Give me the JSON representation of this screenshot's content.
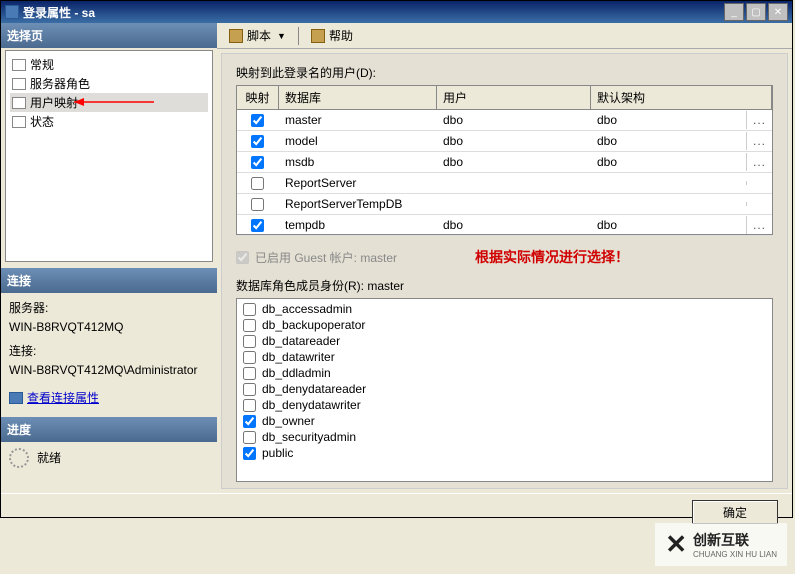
{
  "window": {
    "title": "登录属性 - sa"
  },
  "toolbar": {
    "script": "脚本",
    "help": "帮助"
  },
  "left": {
    "select_page_header": "选择页",
    "tree": [
      {
        "label": "常规"
      },
      {
        "label": "服务器角色"
      },
      {
        "label": "用户映射",
        "selected": true
      },
      {
        "label": "状态"
      }
    ],
    "conn_header": "连接",
    "server_label": "服务器:",
    "server_value": "WIN-B8RVQT412MQ",
    "conn_label": "连接:",
    "conn_value": "WIN-B8RVQT412MQ\\Administrator",
    "view_conn_link": "查看连接属性",
    "progress_header": "进度",
    "progress_status": "就绪"
  },
  "main": {
    "map_label": "映射到此登录名的用户(D):",
    "grid": {
      "headers": {
        "map": "映射",
        "db": "数据库",
        "user": "用户",
        "schema": "默认架构"
      },
      "rows": [
        {
          "checked": true,
          "db": "master",
          "user": "dbo",
          "schema": "dbo",
          "btn": true
        },
        {
          "checked": true,
          "db": "model",
          "user": "dbo",
          "schema": "dbo",
          "btn": true
        },
        {
          "checked": true,
          "db": "msdb",
          "user": "dbo",
          "schema": "dbo",
          "btn": true
        },
        {
          "checked": false,
          "db": "ReportServer",
          "user": "",
          "schema": "",
          "btn": false
        },
        {
          "checked": false,
          "db": "ReportServerTempDB",
          "user": "",
          "schema": "",
          "btn": false
        },
        {
          "checked": true,
          "db": "tempdb",
          "user": "dbo",
          "schema": "dbo",
          "btn": true
        }
      ]
    },
    "guest_enabled_label": "已启用 Guest 帐户: master",
    "annotation": "根据实际情况进行选择！",
    "roles_label": "数据库角色成员身份(R): master",
    "roles": [
      {
        "name": "db_accessadmin",
        "checked": false
      },
      {
        "name": "db_backupoperator",
        "checked": false
      },
      {
        "name": "db_datareader",
        "checked": false
      },
      {
        "name": "db_datawriter",
        "checked": false
      },
      {
        "name": "db_ddladmin",
        "checked": false
      },
      {
        "name": "db_denydatareader",
        "checked": false
      },
      {
        "name": "db_denydatawriter",
        "checked": false
      },
      {
        "name": "db_owner",
        "checked": true
      },
      {
        "name": "db_securityadmin",
        "checked": false
      },
      {
        "name": "public",
        "checked": true
      }
    ]
  },
  "footer": {
    "ok": "确定"
  },
  "watermark": {
    "cn": "创新互联",
    "en": "CHUANG XIN HU LIAN"
  }
}
